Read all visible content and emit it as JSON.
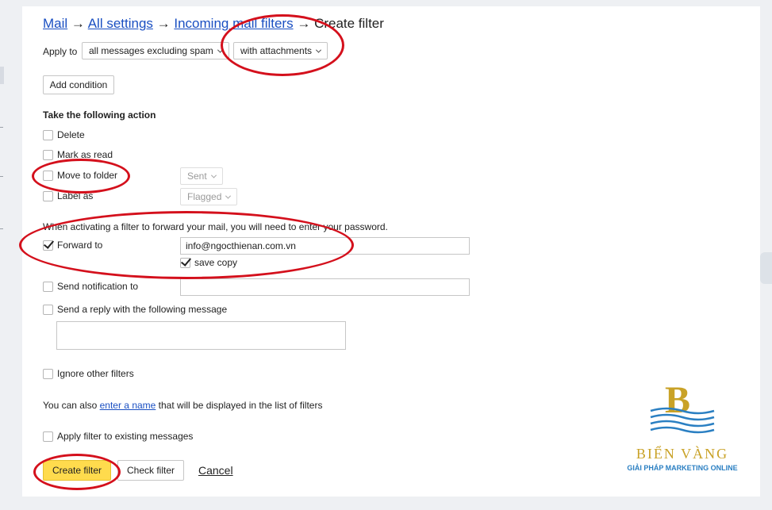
{
  "breadcrumb": {
    "mail": "Mail",
    "arrow1": "→",
    "all_settings": "All settings",
    "arrow2": "→",
    "incoming_filters": "Incoming mail filters",
    "arrow3": "→",
    "current": "Create filter"
  },
  "apply": {
    "label": "Apply to",
    "scope_value": "all messages excluding spam",
    "attachments_value": "with attachments"
  },
  "add_condition_label": "Add condition",
  "actions": {
    "heading": "Take the following action",
    "delete": "Delete",
    "mark_read": "Mark as read",
    "move_folder": "Move to folder",
    "folder_value": "Sent",
    "label_as": "Label as",
    "label_value": "Flagged",
    "forward_note": "When activating a filter to forward your mail, you will need to enter your password.",
    "forward_to": "Forward to",
    "forward_email": "info@ngocthienan.com.vn",
    "save_copy": "save copy",
    "send_notification": "Send notification to",
    "send_reply": "Send a reply with the following message",
    "ignore_other": "Ignore other filters"
  },
  "name_note": {
    "prefix": "You can also ",
    "link": "enter a name",
    "suffix": " that will be displayed in the list of filters"
  },
  "apply_existing": "Apply filter to existing messages",
  "buttons": {
    "create": "Create filter",
    "check": "Check filter",
    "cancel": "Cancel"
  },
  "checkboxes": {
    "delete": false,
    "mark_read": false,
    "move_folder": false,
    "label_as": false,
    "forward_to": true,
    "save_copy": true,
    "send_notification": false,
    "send_reply": false,
    "ignore_other": false,
    "apply_existing": false
  },
  "logo": {
    "letter": "B",
    "name": "BIỂN VÀNG",
    "tagline": "GIẢI PHÁP MARKETING ONLINE"
  },
  "colors": {
    "link": "#1a4fc2",
    "primary_button": "#ffdb4d",
    "annotation": "#d4101c",
    "logo_gold": "#c9a227",
    "logo_blue": "#2a7fc2"
  }
}
